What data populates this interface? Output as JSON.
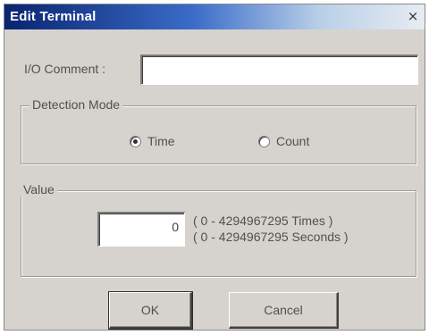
{
  "window": {
    "title": "Edit Terminal",
    "close_glyph": "×"
  },
  "io_comment": {
    "label": "I/O Comment :",
    "value": ""
  },
  "detection_mode": {
    "caption": "Detection Mode",
    "options": [
      {
        "label": "Time",
        "selected": true
      },
      {
        "label": "Count",
        "selected": false
      }
    ]
  },
  "value_group": {
    "caption": "Value",
    "value": "0",
    "range_times": "( 0 - 4294967295 Times )",
    "range_seconds": "( 0 - 4294967295 Seconds )"
  },
  "buttons": {
    "ok": "OK",
    "cancel": "Cancel"
  }
}
